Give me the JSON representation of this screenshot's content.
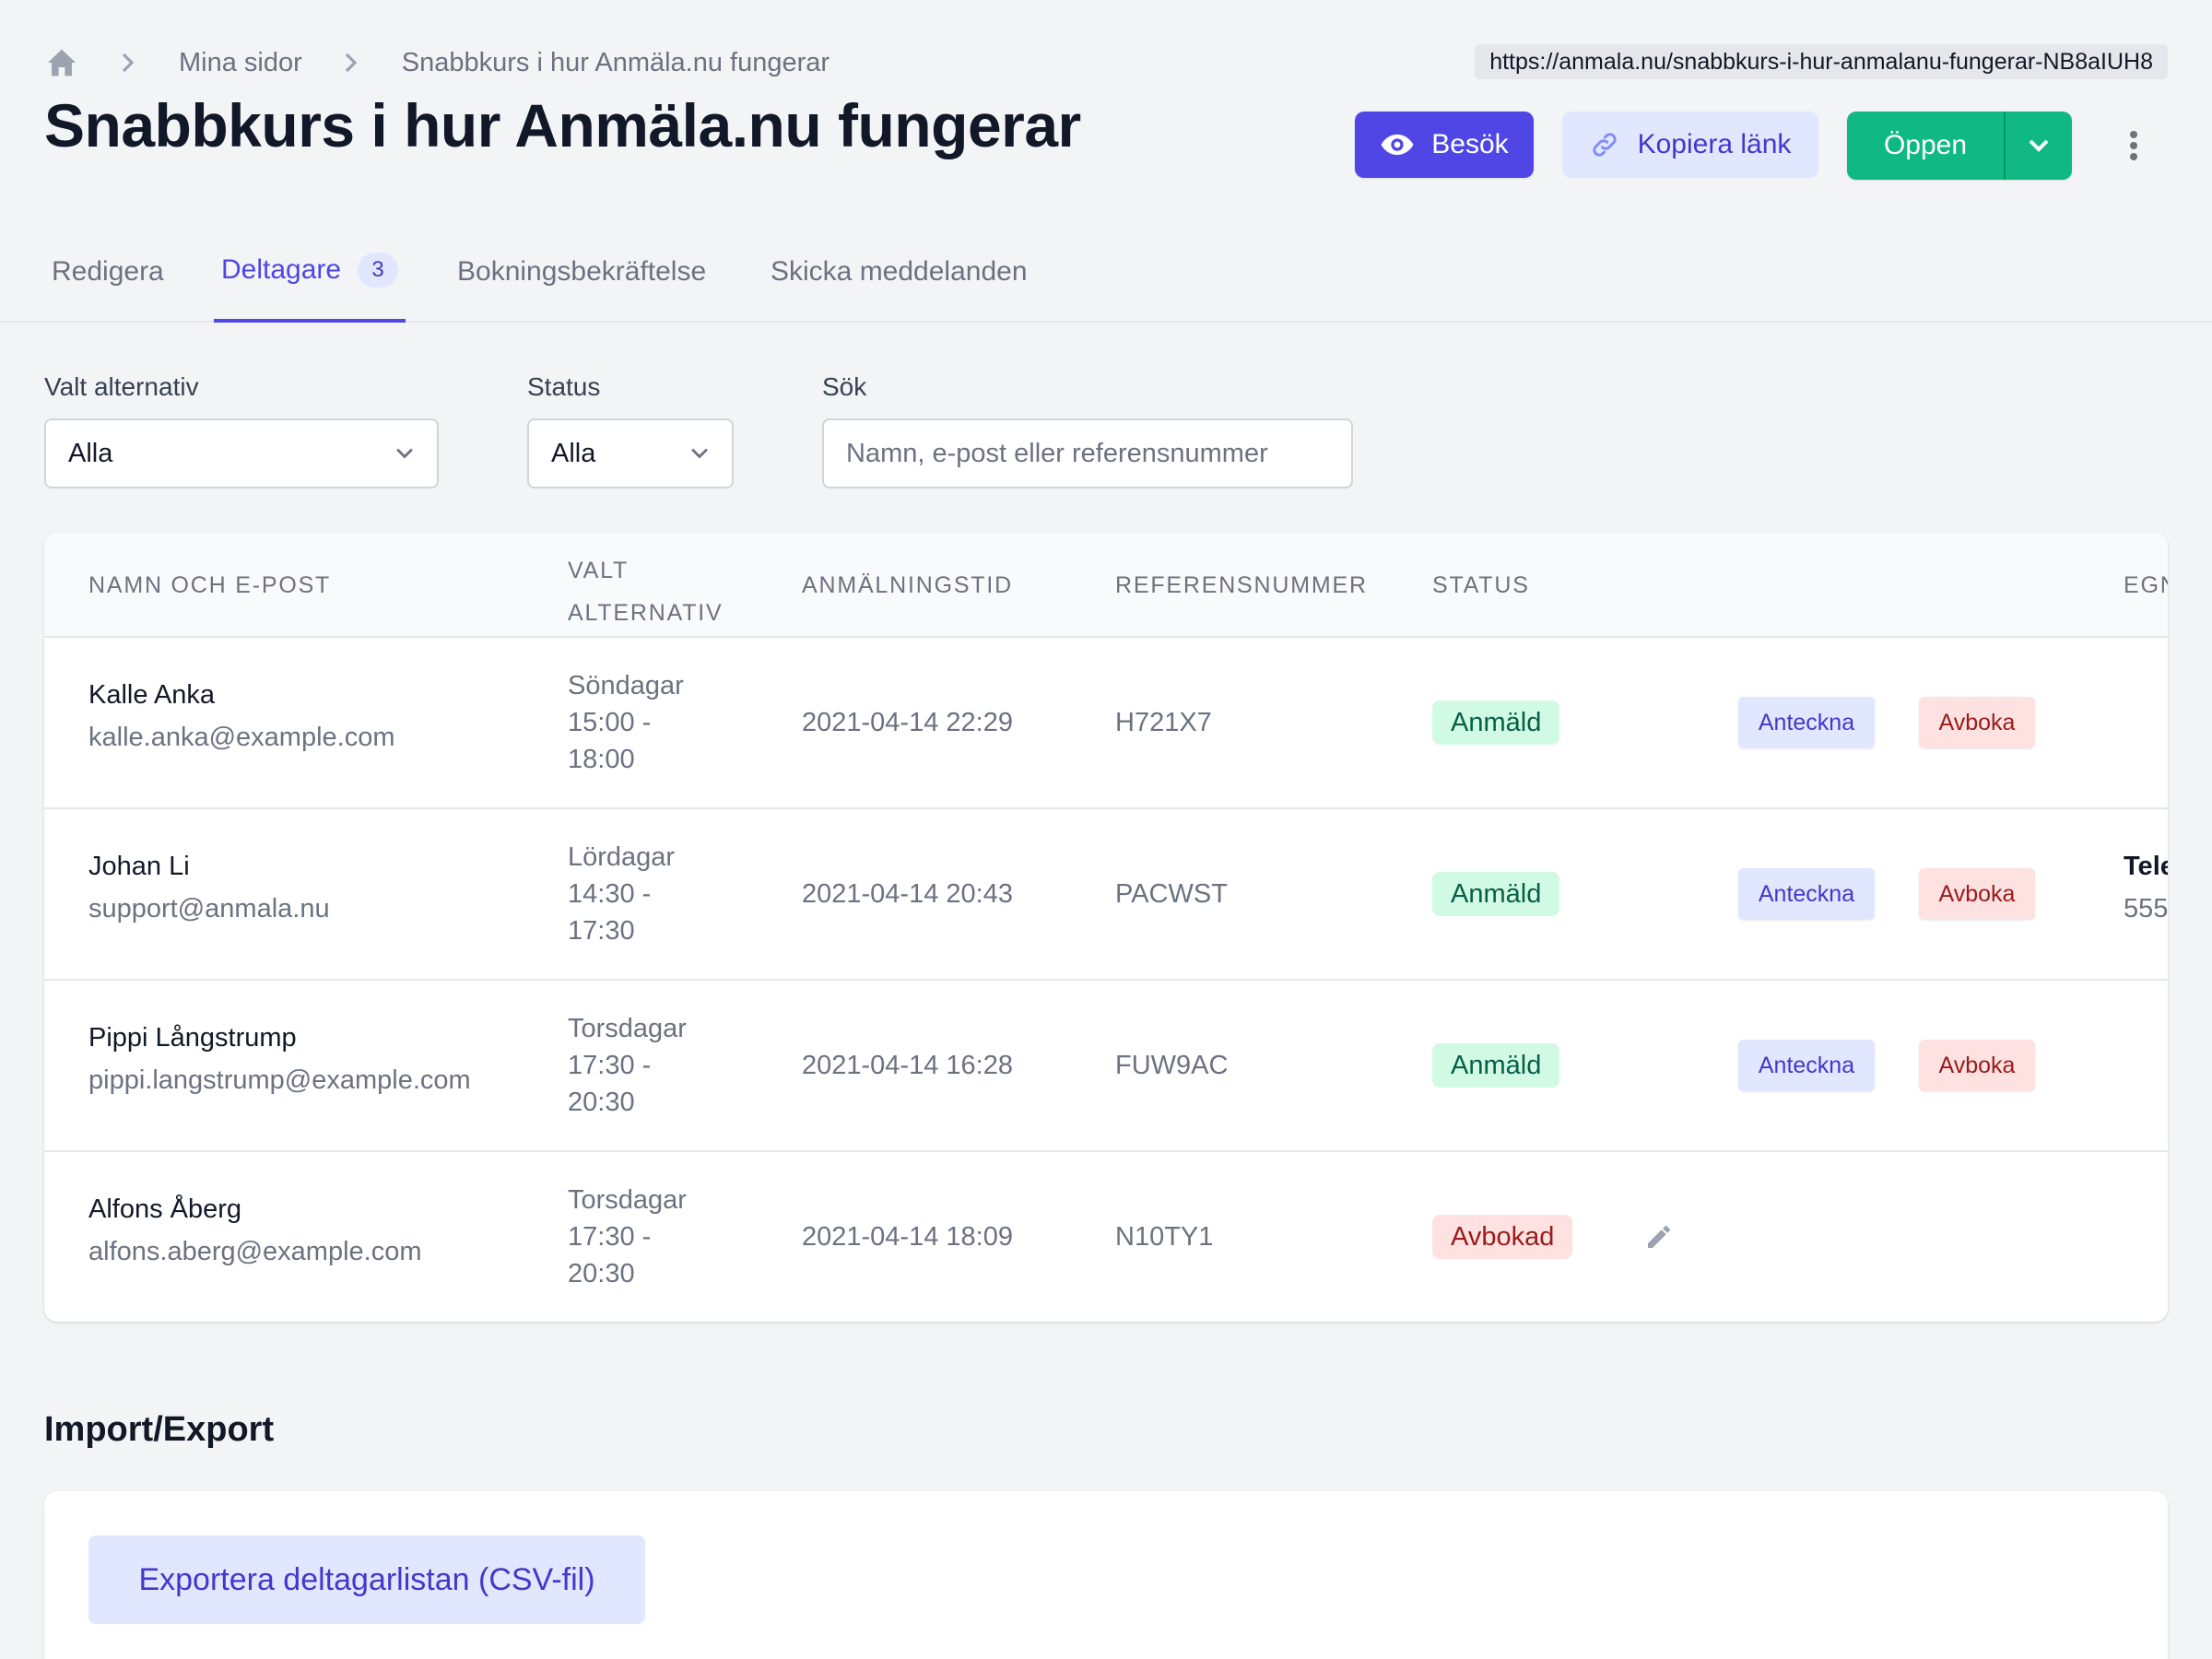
{
  "breadcrumb": {
    "home_icon": "home-icon",
    "items": [
      "Mina sidor",
      "Snabbkurs i hur Anmäla.nu fungerar"
    ]
  },
  "url": "https://anmala.nu/snabbkurs-i-hur-anmalanu-fungerar-NB8aIUH8",
  "page_title": "Snabbkurs i hur Anmäla.nu fungerar",
  "actions": {
    "visit_label": "Besök",
    "copy_link_label": "Kopiera länk",
    "open_label": "Öppen"
  },
  "tabs": [
    {
      "label": "Redigera"
    },
    {
      "label": "Deltagare",
      "count": "3",
      "active": true
    },
    {
      "label": "Bokningsbekräftelse"
    },
    {
      "label": "Skicka meddelanden"
    }
  ],
  "filters": {
    "option_label": "Valt alternativ",
    "option_value": "Alla",
    "status_label": "Status",
    "status_value": "Alla",
    "search_label": "Sök",
    "search_placeholder": "Namn, e-post eller referensnummer"
  },
  "table": {
    "headers": {
      "name_email": "NAMN OCH E-POST",
      "option_line1": "VALT",
      "option_line2": "ALTERNATIV",
      "signup_time": "ANMÄLNINGSTID",
      "reference": "REFERENSNUMMER",
      "status": "STATUS",
      "custom_partial": "EGN"
    },
    "rows": [
      {
        "name": "Kalle Anka",
        "email": "kalle.anka@example.com",
        "option": [
          "Söndagar",
          "15:00 -",
          "18:00"
        ],
        "time": "2021-04-14 22:29",
        "ref": "H721X7",
        "status": "Anmäld",
        "status_kind": "ok",
        "note_label": "Anteckna",
        "cancel_label": "Avboka",
        "extra": [
          "",
          ""
        ]
      },
      {
        "name": "Johan Li",
        "email": "support@anmala.nu",
        "option": [
          "Lördagar",
          "14:30 -",
          "17:30"
        ],
        "time": "2021-04-14 20:43",
        "ref": "PACWST",
        "status": "Anmäld",
        "status_kind": "ok",
        "note_label": "Anteckna",
        "cancel_label": "Avboka",
        "extra": [
          "Tele",
          "555"
        ]
      },
      {
        "name": "Pippi Långstrump",
        "email": "pippi.langstrump@example.com",
        "option": [
          "Torsdagar",
          "17:30 -",
          "20:30"
        ],
        "time": "2021-04-14 16:28",
        "ref": "FUW9AC",
        "status": "Anmäld",
        "status_kind": "ok",
        "note_label": "Anteckna",
        "cancel_label": "Avboka",
        "extra": [
          "",
          ""
        ]
      },
      {
        "name": "Alfons Åberg",
        "email": "alfons.aberg@example.com",
        "option": [
          "Torsdagar",
          "17:30 -",
          "20:30"
        ],
        "time": "2021-04-14 18:09",
        "ref": "N10TY1",
        "status": "Avbokad",
        "status_kind": "bad",
        "edit_icon": "pencil-icon",
        "extra": [
          "",
          ""
        ]
      }
    ]
  },
  "import_export": {
    "title": "Import/Export",
    "export_label": "Exportera deltagarlistan (CSV-fil)"
  },
  "colors": {
    "primary": "#4f46e5",
    "success": "#10b981",
    "danger_bg": "#fee2e2",
    "success_bg": "#d1fae5"
  }
}
